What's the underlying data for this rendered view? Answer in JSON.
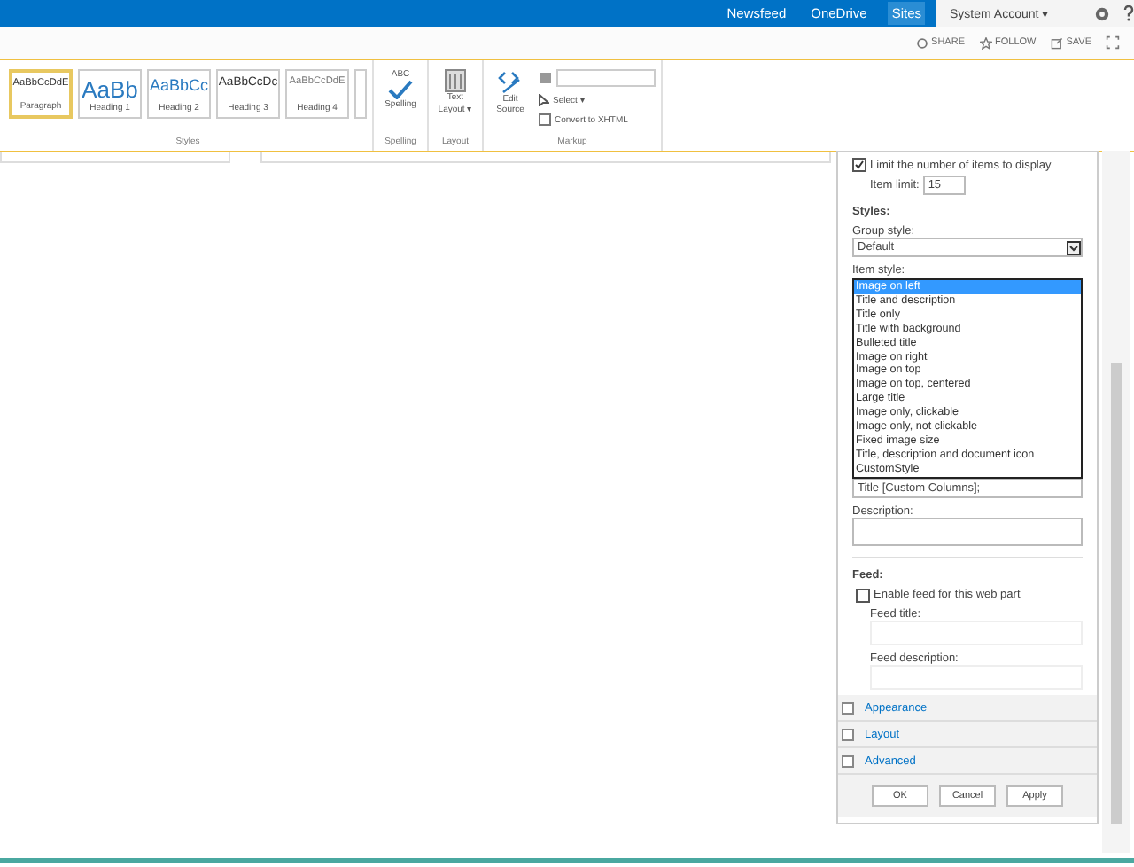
{
  "top_bar": {
    "links": [
      {
        "label": "Newsfeed",
        "selected": false
      },
      {
        "label": "OneDrive",
        "selected": false
      },
      {
        "label": "Sites",
        "selected": true
      }
    ],
    "account": "System Account ▾"
  },
  "actions": [
    "SHARE",
    "FOLLOW",
    "SAVE"
  ],
  "ribbon": {
    "styles": [
      {
        "sample": "AaBbCcDdE",
        "label": "Paragraph",
        "kind": "paragraph",
        "selected": true
      },
      {
        "sample": "AaBb",
        "label": "Heading 1",
        "kind": "h1",
        "selected": false
      },
      {
        "sample": "AaBbCc",
        "label": "Heading 2",
        "kind": "h2",
        "selected": false
      },
      {
        "sample": "AaBbCcDc",
        "label": "Heading 3",
        "kind": "h3",
        "selected": false
      },
      {
        "sample": "AaBbCcDdE",
        "label": "Heading 4",
        "kind": "h4",
        "selected": false
      }
    ],
    "groups": [
      {
        "name": "Styles"
      },
      {
        "name": "Spelling",
        "top": "ABC",
        "label": "Spelling"
      },
      {
        "name": "Layout",
        "label": "Text Layout ▾"
      },
      {
        "name": "Markup",
        "label": "Edit Source",
        "items": [
          "Select ▾",
          "Convert to XHTML"
        ]
      }
    ]
  },
  "panel": {
    "limit": {
      "label": "Limit the number of items to display",
      "checked": true
    },
    "item_limit": {
      "label": "Item limit:",
      "value": "15"
    },
    "styles_heading": "Styles:",
    "group_style": {
      "label": "Group style:",
      "value": "Default"
    },
    "item_style": {
      "label": "Item style:",
      "options": [
        {
          "label": "Image on left",
          "selected": true
        },
        {
          "label": "Title and description",
          "selected": false
        },
        {
          "label": "Title only",
          "selected": false
        },
        {
          "label": "Title with background",
          "selected": false
        },
        {
          "label": "Bulleted title",
          "selected": false
        },
        {
          "label": "Image on right",
          "selected": false
        },
        {
          "label": "Image on top",
          "selected": false
        },
        {
          "label": "Image on top, centered",
          "selected": false
        },
        {
          "label": "Large title",
          "selected": false
        },
        {
          "label": "Image only, clickable",
          "selected": false
        },
        {
          "label": "Image only, not clickable",
          "selected": false
        },
        {
          "label": "Fixed image size",
          "selected": false
        },
        {
          "label": "Title, description and document icon",
          "selected": false
        },
        {
          "label": "CustomStyle",
          "selected": false
        }
      ]
    },
    "title_field": {
      "value": "Title [Custom Columns];"
    },
    "description": {
      "label": "Description:"
    },
    "feed_heading": "Feed:",
    "enable_feed": {
      "label": "Enable feed for this web part",
      "checked": false
    },
    "feed_title": {
      "label": "Feed title:"
    },
    "feed_description": {
      "label": "Feed description:"
    },
    "sections": [
      "Appearance",
      "Layout",
      "Advanced"
    ],
    "buttons": [
      "OK",
      "Cancel",
      "Apply"
    ]
  }
}
